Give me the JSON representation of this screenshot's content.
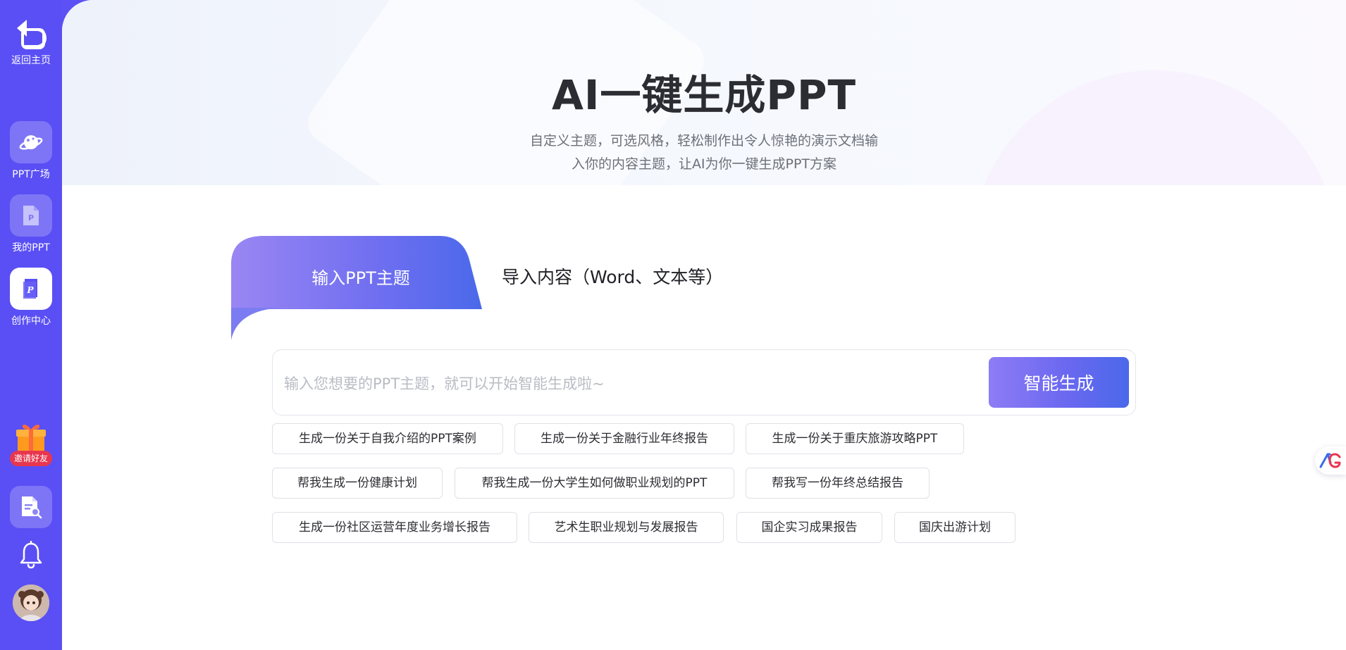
{
  "sidebar": {
    "back_home_label": "返回主页",
    "nav": [
      {
        "label": "PPT广场",
        "icon": "planet-icon"
      },
      {
        "label": "我的PPT",
        "icon": "ppt-file-icon"
      },
      {
        "label": "创作中心",
        "icon": "create-ppt-icon",
        "active": true
      }
    ],
    "invite_label": "邀请好友",
    "bottom_icons": [
      "document-search-icon",
      "bell-icon",
      "avatar"
    ]
  },
  "hero": {
    "title": "AI一键生成PPT",
    "subtitle_line1": "自定义主题，可选风格，轻松制作出令人惊艳的演示文档输",
    "subtitle_line2": "入你的内容主题，让AI为你一键生成PPT方案"
  },
  "tabs": {
    "active": "输入PPT主题",
    "secondary": "导入内容（Word、文本等）"
  },
  "search": {
    "placeholder": "输入您想要的PPT主题，就可以开始智能生成啦~",
    "value": "",
    "button_label": "智能生成"
  },
  "suggestions": [
    [
      "生成一份关于自我介绍的PPT案例",
      "生成一份关于金融行业年终报告",
      "生成一份关于重庆旅游攻略PPT"
    ],
    [
      "帮我生成一份健康计划",
      "帮我生成一份大学生如何做职业规划的PPT",
      "帮我写一份年终总结报告"
    ],
    [
      "生成一份社区运营年度业务增长报告",
      "艺术生职业规划与发展报告",
      "国企实习成果报告",
      "国庆出游计划"
    ]
  ],
  "colors": {
    "sidebar": "#5a4ff4",
    "accent_gradient_start": "#8d7cf5",
    "accent_gradient_end": "#4a69ea",
    "invite_badge": "#e8364f"
  },
  "float_logo_text": "AG"
}
